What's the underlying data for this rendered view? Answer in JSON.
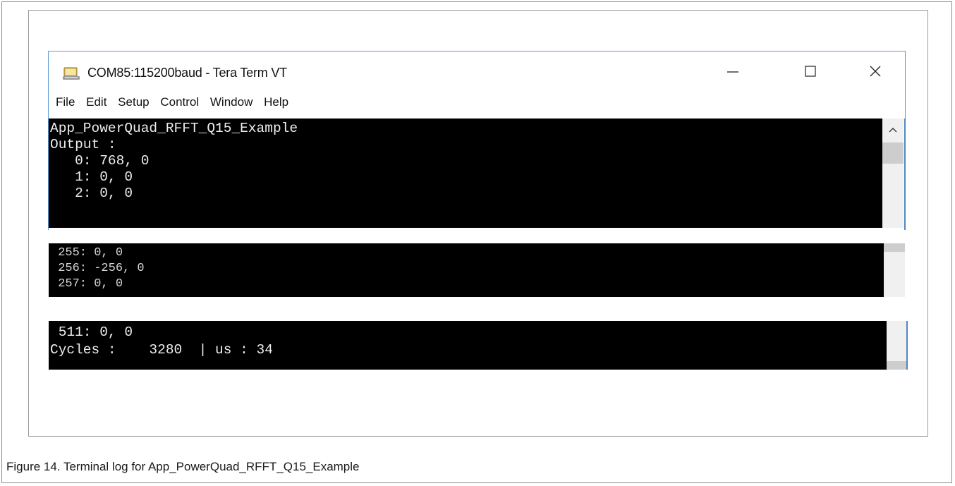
{
  "window": {
    "title": "COM85:115200baud - Tera Term VT",
    "minimize_label": "—",
    "maximize_label": "☐",
    "close_label": "✕",
    "icon": "teraterm-app-icon"
  },
  "menu": [
    "File",
    "Edit",
    "Setup",
    "Control",
    "Window",
    "Help"
  ],
  "terminal": {
    "main_lines": [
      "App_PowerQuad_RFFT_Q15_Example",
      "Output :",
      "   0: 768, 0",
      "   1: 0, 0",
      "   2: 0, 0"
    ],
    "segment2_lines": [
      " 255: 0, 0",
      " 256: -256, 0",
      " 257: 0, 0"
    ],
    "segment3_lines": [
      " 511: 0, 0",
      "Cycles :    3280  | us : 34"
    ]
  },
  "scrollbar": {
    "up_arrow": "^"
  },
  "caption": "Figure 14.  Terminal log for App_PowerQuad_RFFT_Q15_Example"
}
